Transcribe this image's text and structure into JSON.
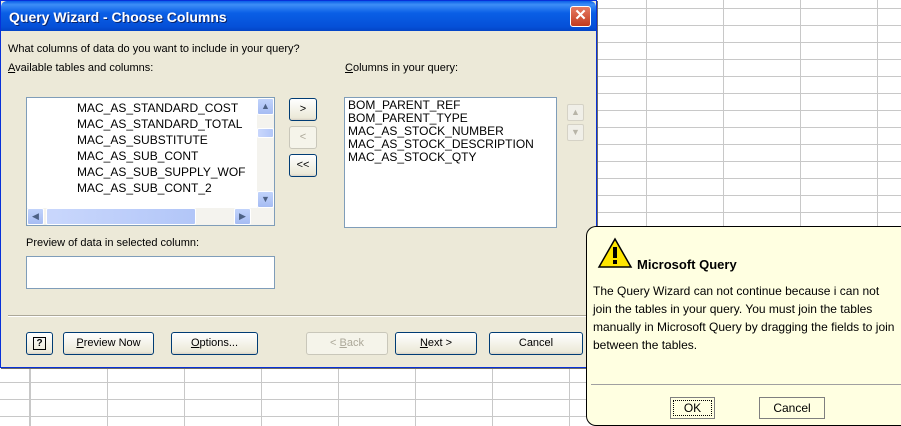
{
  "dialog": {
    "title": "Query Wizard - Choose Columns",
    "close_glyph": "✕",
    "prompt": "What columns of data do you want to include in your query?",
    "available_label_u": "A",
    "available_label_rest": "vailable tables and columns:",
    "available_items": [
      "MAC_AS_STANDARD_COST",
      "MAC_AS_STANDARD_TOTAL",
      "MAC_AS_SUBSTITUTE",
      "MAC_AS_SUB_CONT",
      "MAC_AS_SUB_SUPPLY_WOF",
      "MAC_AS_SUB_CONT_2"
    ],
    "columns_label_u": "C",
    "columns_label_rest": "olumns in your query:",
    "query_columns": [
      "BOM_PARENT_REF",
      "BOM_PARENT_TYPE",
      "MAC_AS_STOCK_NUMBER",
      "MAC_AS_STOCK_DESCRIPTION",
      "MAC_AS_STOCK_QTY"
    ],
    "add_btn": ">",
    "remove_btn": "<",
    "remove_all_btn": "<<",
    "preview_label": "Preview of data in selected column:",
    "help_glyph": "?",
    "preview_now_u": "P",
    "preview_now_rest": "review Now",
    "options_u": "O",
    "options_rest": "ptions...",
    "back_pre": "< ",
    "back_u": "B",
    "back_rest": "ack",
    "next_u": "N",
    "next_rest": "ext >",
    "cancel": "Cancel"
  },
  "balloon": {
    "title": "Microsoft Query",
    "message": "The Query Wizard can not continue because i can not join the tables in your query.  You must join the tables manually in Microsoft Query by dragging the fields to join between the tables.",
    "ok": "OK",
    "cancel": "Cancel"
  },
  "colors": {
    "title_bar": "#0a5fe6",
    "dialog_bg": "#ece9d8",
    "balloon_bg": "#ffffe1"
  }
}
